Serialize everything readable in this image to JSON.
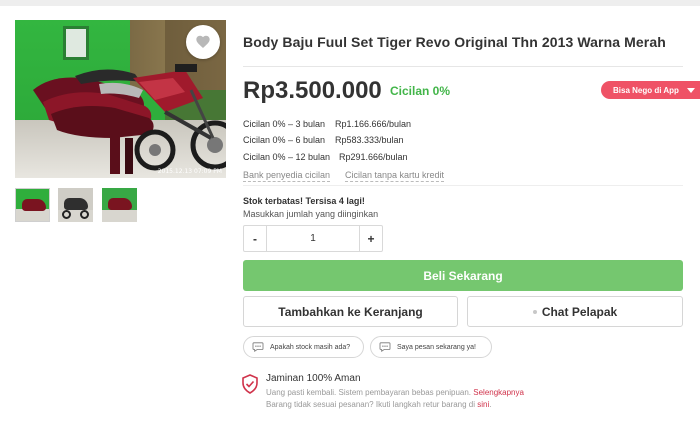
{
  "gallery": {
    "photo_stamp": "2015.12.13 07:09 PM",
    "wishlist_icon": "heart-icon",
    "thumbnail_count": 3
  },
  "product": {
    "title": "Body Baju Fuul Set Tiger Revo Original Thn 2013 Warna Merah",
    "price": "Rp3.500.000",
    "cicilan_zero": "Cicilan 0%",
    "nego_badge": "Bisa Nego di App"
  },
  "installments": [
    {
      "term": "Cicilan 0% – 3 bulan",
      "amount": "Rp1.166.666/bulan"
    },
    {
      "term": "Cicilan 0% – 6 bulan",
      "amount": "Rp583.333/bulan"
    },
    {
      "term": "Cicilan 0% – 12 bulan",
      "amount": "Rp291.666/bulan"
    }
  ],
  "installment_links": {
    "bank": "Bank penyedia cicilan",
    "no_card": "Cicilan tanpa kartu kredit"
  },
  "purchase": {
    "stock_note": "Stok terbatas! Tersisa 4 lagi!",
    "qty_label": "Masukkan jumlah yang diinginkan",
    "qty_minus": "-",
    "qty_value": "1",
    "qty_plus": "+",
    "buy_label": "Beli Sekarang",
    "cart_label": "Tambahkan ke Keranjang",
    "chat_label": "Chat Pelapak"
  },
  "quick_replies": [
    "Apakah stock masih ada?",
    "Saya pesan sekarang ya!"
  ],
  "guarantee": {
    "title": "Jaminan 100% Aman",
    "line1_text": "Uang pasti kembali. Sistem pembayaran bebas penipuan.",
    "line1_link": "Selengkapnya",
    "line2_text": "Barang tidak sesuai pesanan? Ikuti langkah retur barang di",
    "line2_link": "sini",
    "line2_end": "."
  },
  "colors": {
    "green_primary": "#42b549",
    "buy_button": "#75c76f",
    "nego_badge": "#ef5266",
    "link_red": "#d0334b"
  }
}
